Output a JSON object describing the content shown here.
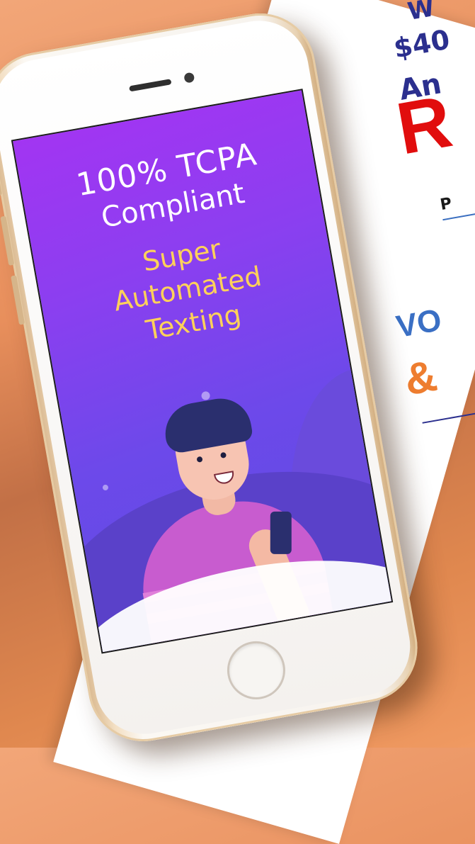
{
  "background_ad": {
    "lines": [
      "W",
      "$40",
      "An",
      "R",
      "P",
      "VO",
      "&"
    ],
    "colors": {
      "navy": "#2b2f8e",
      "red": "#e10d0d",
      "blue": "#3a6fc4",
      "orange": "#ee7d2f"
    }
  },
  "phone_screen": {
    "headline_line1": "100% TCPA",
    "headline_line2": "Compliant",
    "tagline_line1": "Super",
    "tagline_line2": "Automated",
    "tagline_line3": "Texting",
    "colors": {
      "headline": "#ffffff",
      "tagline": "#ffd15a",
      "gradient_top": "#a235f2",
      "gradient_bottom": "#5a4bdf"
    }
  }
}
